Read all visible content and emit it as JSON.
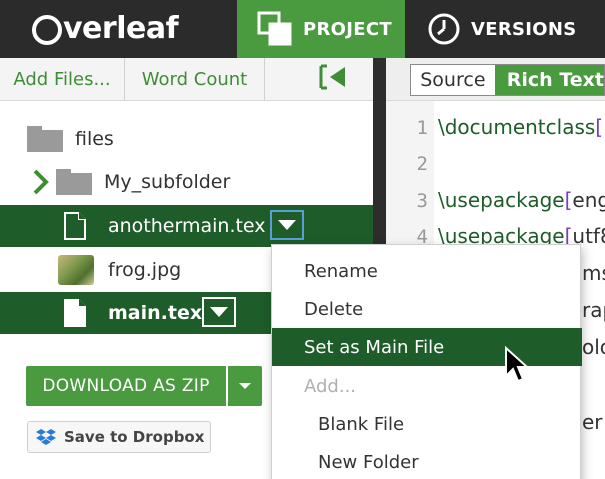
{
  "header": {
    "logo_text": "verleaf",
    "project_tab": "PROJECT",
    "versions_tab": "VERSIONS"
  },
  "toolbar": {
    "add_files": "Add Files...",
    "word_count": "Word Count",
    "collapse_icon": "collapse-left-icon"
  },
  "tree": {
    "root": "files",
    "subfolder": "My_subfolder",
    "file1": "anothermain.tex",
    "file2": "frog.jpg",
    "file3": "main.tex"
  },
  "actions": {
    "download_zip": "DOWNLOAD AS ZIP",
    "dropbox": "Save to Dropbox"
  },
  "editor": {
    "mode_source": "Source",
    "mode_rich": "Rich Text",
    "line_numbers": [
      "1",
      "2",
      "3",
      "4"
    ],
    "lines": [
      {
        "cmd": "\\documentclass",
        "open": "[",
        "arg": ""
      },
      {
        "cmd": "",
        "open": "",
        "arg": ""
      },
      {
        "cmd": "\\usepackage",
        "open": "[",
        "arg": "eng"
      },
      {
        "cmd": "\\usepackage",
        "open": "[",
        "arg": "utf8"
      }
    ],
    "peek_fragments": [
      "ms",
      "rap",
      "olo",
      "er}"
    ]
  },
  "context_menu": {
    "rename": "Rename",
    "delete": "Delete",
    "set_main": "Set as Main File",
    "add": "Add...",
    "blank_file": "Blank File",
    "new_folder": "New Folder"
  },
  "colors": {
    "brand_green": "#4a9a3f",
    "selected_green": "#1e5c2a",
    "topbar": "#2b2b2b"
  }
}
